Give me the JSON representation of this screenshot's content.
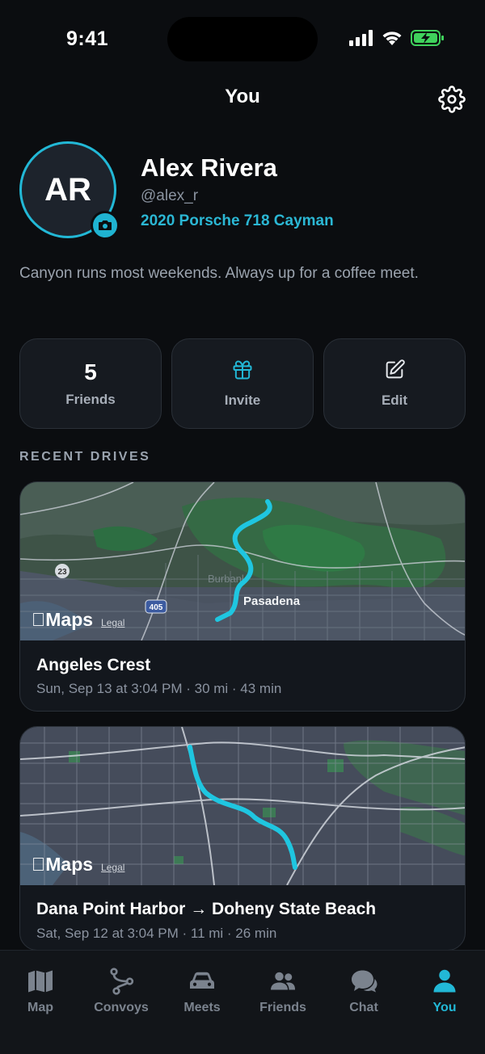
{
  "status": {
    "time": "9:41"
  },
  "header": {
    "title": "You"
  },
  "profile": {
    "initials": "AR",
    "name": "Alex Rivera",
    "handle": "@alex_r",
    "car": "2020 Porsche 718 Cayman",
    "bio": "Canyon runs most weekends. Always up for a coffee meet."
  },
  "actions": {
    "friends_count": "5",
    "friends_label": "Friends",
    "invite_label": "Invite",
    "edit_label": "Edit"
  },
  "section_title": "RECENT DRIVES",
  "drives": [
    {
      "title": "Angeles Crest",
      "meta": "Sun, Sep 13 at 3:04 PM · 30 mi · 43 min",
      "map_labels": {
        "city": "Pasadena",
        "shield1": "23",
        "shield2": "405",
        "faint": "Burbank"
      }
    },
    {
      "title": "Dana Point Harbor → Doheny State Beach",
      "meta": "Sat, Sep 12 at 3:04 PM · 11 mi · 26 min"
    }
  ],
  "maps_badge": {
    "logo": "Maps",
    "legal": "Legal"
  },
  "tabs": [
    {
      "label": "Map",
      "icon": "map-icon"
    },
    {
      "label": "Convoys",
      "icon": "route-icon"
    },
    {
      "label": "Meets",
      "icon": "car-icon"
    },
    {
      "label": "Friends",
      "icon": "people-icon"
    },
    {
      "label": "Chat",
      "icon": "chat-icon"
    },
    {
      "label": "You",
      "icon": "person-icon",
      "active": true
    }
  ],
  "colors": {
    "accent": "#22b8d6",
    "background": "#0b0d10",
    "card": "#13171d"
  }
}
